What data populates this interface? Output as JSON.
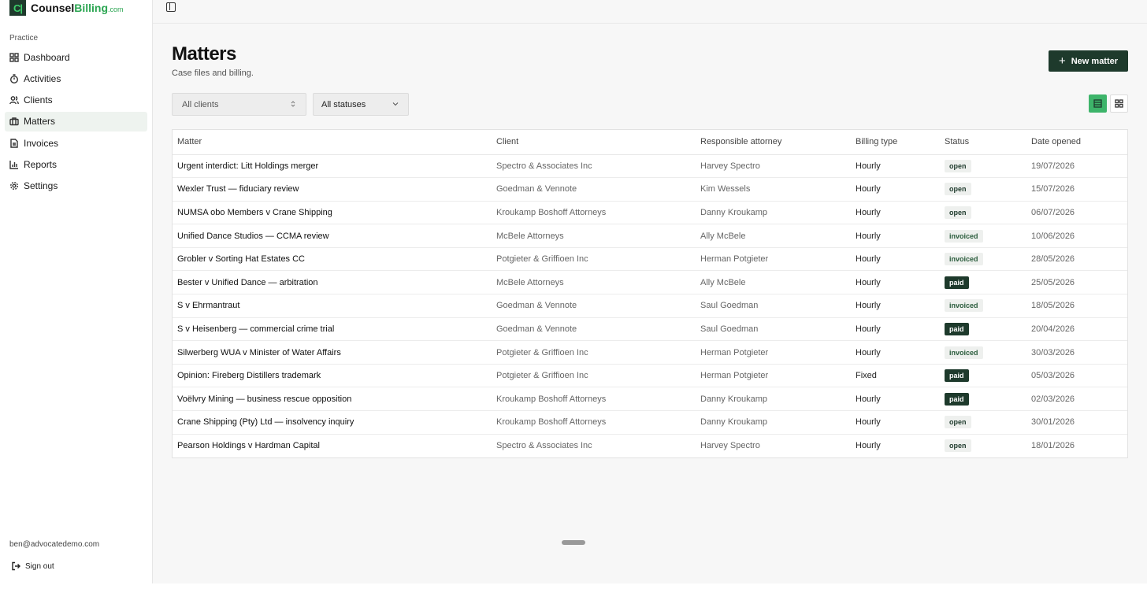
{
  "brand": {
    "logo": "C|",
    "name_a": "Counsel",
    "name_b": "Billing",
    "suffix": ".com"
  },
  "sidebar": {
    "section": "Practice",
    "items": [
      {
        "label": "Dashboard",
        "icon": "grid-icon"
      },
      {
        "label": "Activities",
        "icon": "timer-icon"
      },
      {
        "label": "Clients",
        "icon": "users-icon"
      },
      {
        "label": "Matters",
        "icon": "briefcase-icon",
        "active": true
      },
      {
        "label": "Invoices",
        "icon": "document-icon"
      },
      {
        "label": "Reports",
        "icon": "bar-chart-icon"
      },
      {
        "label": "Settings",
        "icon": "gear-icon"
      }
    ],
    "email": "ben@advocatedemo.com",
    "signout": "Sign out"
  },
  "page": {
    "title": "Matters",
    "subtitle": "Case files and billing.",
    "new_button": "New matter",
    "filters": {
      "clients": "All clients",
      "statuses": "All statuses"
    }
  },
  "table": {
    "headers": [
      "Matter",
      "Client",
      "Responsible attorney",
      "Billing type",
      "Status",
      "Date opened"
    ],
    "rows": [
      [
        "Urgent interdict: Litt Holdings merger",
        "Spectro & Associates Inc",
        "Harvey Spectro",
        "Hourly",
        "open",
        "19/07/2026"
      ],
      [
        "Wexler Trust — fiduciary review",
        "Goedman & Vennote",
        "Kim Wessels",
        "Hourly",
        "open",
        "15/07/2026"
      ],
      [
        "NUMSA obo Members v Crane Shipping",
        "Kroukamp Boshoff Attorneys",
        "Danny Kroukamp",
        "Hourly",
        "open",
        "06/07/2026"
      ],
      [
        "Unified Dance Studios — CCMA review",
        "McBele Attorneys",
        "Ally McBele",
        "Hourly",
        "invoiced",
        "10/06/2026"
      ],
      [
        "Grobler v Sorting Hat Estates CC",
        "Potgieter & Griffioen Inc",
        "Herman Potgieter",
        "Hourly",
        "invoiced",
        "28/05/2026"
      ],
      [
        "Bester v Unified Dance — arbitration",
        "McBele Attorneys",
        "Ally McBele",
        "Hourly",
        "paid",
        "25/05/2026"
      ],
      [
        "S v Ehrmantraut",
        "Goedman & Vennote",
        "Saul Goedman",
        "Hourly",
        "invoiced",
        "18/05/2026"
      ],
      [
        "S v Heisenberg — commercial crime trial",
        "Goedman & Vennote",
        "Saul Goedman",
        "Hourly",
        "paid",
        "20/04/2026"
      ],
      [
        "Silwerberg WUA v Minister of Water Affairs",
        "Potgieter & Griffioen Inc",
        "Herman Potgieter",
        "Hourly",
        "invoiced",
        "30/03/2026"
      ],
      [
        "Opinion: Fireberg Distillers trademark",
        "Potgieter & Griffioen Inc",
        "Herman Potgieter",
        "Fixed",
        "paid",
        "05/03/2026"
      ],
      [
        "Voëlvry Mining — business rescue opposition",
        "Kroukamp Boshoff Attorneys",
        "Danny Kroukamp",
        "Hourly",
        "paid",
        "02/03/2026"
      ],
      [
        "Crane Shipping (Pty) Ltd — insolvency inquiry",
        "Kroukamp Boshoff Attorneys",
        "Danny Kroukamp",
        "Hourly",
        "open",
        "30/01/2026"
      ],
      [
        "Pearson Holdings v Hardman Capital",
        "Spectro & Associates Inc",
        "Harvey Spectro",
        "Hourly",
        "open",
        "18/01/2026"
      ]
    ]
  }
}
